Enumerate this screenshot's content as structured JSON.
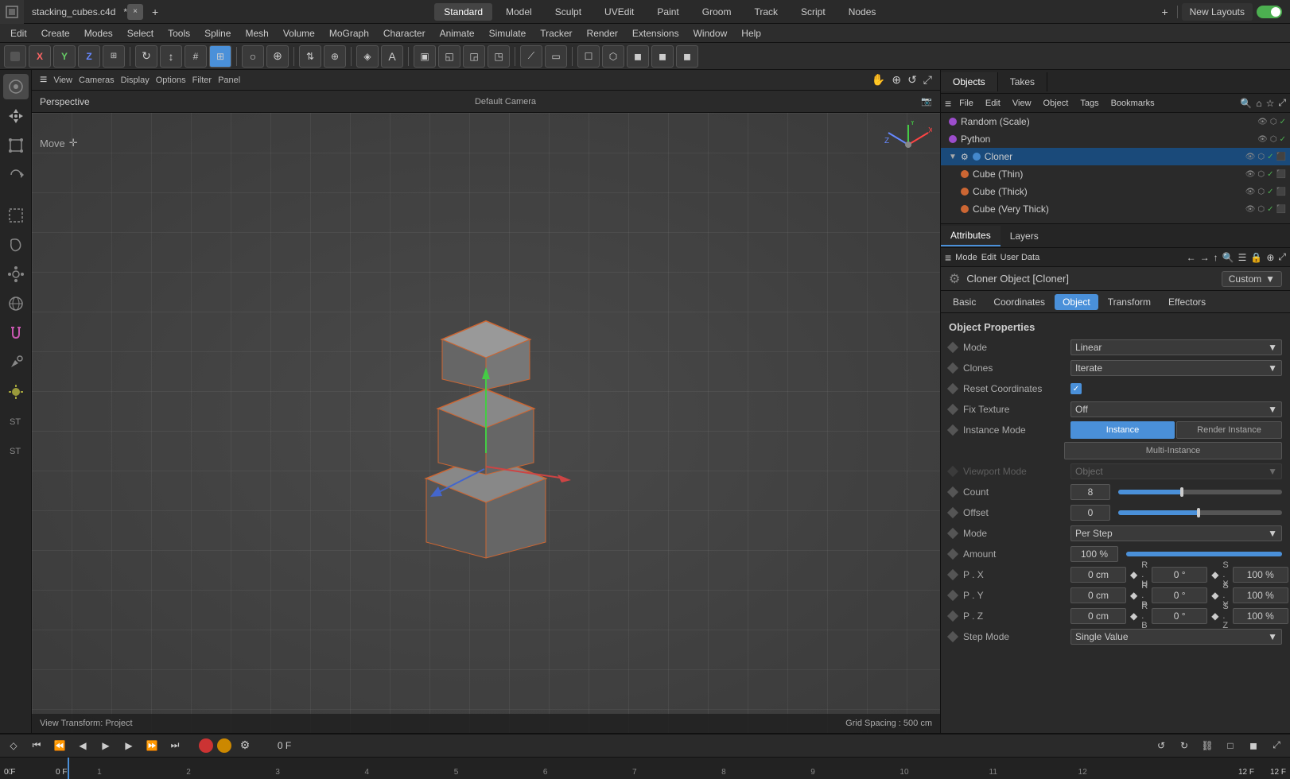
{
  "titlebar": {
    "file_name": "stacking_cubes.c4d",
    "modified": true,
    "close_label": "×",
    "add_tab_label": "+",
    "center_tabs": [
      {
        "label": "Standard",
        "active": true
      },
      {
        "label": "Model",
        "active": false
      },
      {
        "label": "Sculpt",
        "active": false
      },
      {
        "label": "UVEdit",
        "active": false
      },
      {
        "label": "Paint",
        "active": false
      },
      {
        "label": "Groom",
        "active": false
      },
      {
        "label": "Track",
        "active": false
      },
      {
        "label": "Script",
        "active": false
      },
      {
        "label": "Nodes",
        "active": false
      }
    ],
    "new_layouts_label": "New Layouts",
    "plus_icon": "+",
    "toggle_on": true
  },
  "menubar": {
    "items": [
      {
        "label": "Edit"
      },
      {
        "label": "Create"
      },
      {
        "label": "Modes"
      },
      {
        "label": "Select"
      },
      {
        "label": "Tools"
      },
      {
        "label": "Spline"
      },
      {
        "label": "Mesh"
      },
      {
        "label": "Volume"
      },
      {
        "label": "MoGraph"
      },
      {
        "label": "Character"
      },
      {
        "label": "Animate"
      },
      {
        "label": "Simulate"
      },
      {
        "label": "Tracker"
      },
      {
        "label": "Render"
      },
      {
        "label": "Extensions"
      },
      {
        "label": "Window"
      },
      {
        "label": "Help"
      }
    ]
  },
  "viewport": {
    "perspective_label": "Perspective",
    "camera_label": "Default Camera",
    "move_label": "Move",
    "grid_spacing": "Grid Spacing : 500 cm",
    "view_transform": "View Transform: Project",
    "view_tabs": [
      "View",
      "Cameras",
      "Display",
      "Options",
      "Filter",
      "Panel"
    ],
    "axis": {
      "x_color": "#ff4444",
      "y_color": "#44cc44",
      "z_color": "#4444ff"
    }
  },
  "right_panel": {
    "tabs": [
      {
        "label": "Objects",
        "active": true
      },
      {
        "label": "Takes",
        "active": false
      }
    ],
    "panel_tools": [
      "File",
      "Edit",
      "View",
      "Object",
      "Tags",
      "Bookmarks"
    ],
    "objects": [
      {
        "name": "Random (Scale)",
        "type": "effector",
        "indent": 0,
        "dot_color": "purple",
        "has_checkbox": true,
        "checked": true
      },
      {
        "name": "Python",
        "type": "script",
        "indent": 0,
        "dot_color": "purple",
        "has_checkbox": true,
        "checked": true
      },
      {
        "name": "Cloner",
        "type": "cloner",
        "indent": 0,
        "dot_color": "blue",
        "has_gear": true,
        "has_checkbox": true,
        "checked": true,
        "expanded": true
      },
      {
        "name": "Cube (Thin)",
        "type": "cube",
        "indent": 1,
        "dot_color": "orange",
        "has_checkbox": true,
        "checked": true
      },
      {
        "name": "Cube (Thick)",
        "type": "cube",
        "indent": 1,
        "dot_color": "orange",
        "has_checkbox": true,
        "checked": true
      },
      {
        "name": "Cube (Very Thick)",
        "type": "cube",
        "indent": 1,
        "dot_color": "orange",
        "has_checkbox": true,
        "checked": true
      }
    ]
  },
  "attributes": {
    "tabs": [
      {
        "label": "Attributes",
        "active": true
      },
      {
        "label": "Layers",
        "active": false
      }
    ],
    "mode_tabs": [
      "Mode",
      "Edit",
      "User Data"
    ],
    "cloner_title": "Cloner Object [Cloner]",
    "preset_dropdown": "Custom",
    "property_tabs": [
      {
        "label": "Basic",
        "active": false
      },
      {
        "label": "Coordinates",
        "active": false
      },
      {
        "label": "Object",
        "active": true
      },
      {
        "label": "Transform",
        "active": false
      },
      {
        "label": "Effectors",
        "active": false
      }
    ],
    "section_title": "Object Properties",
    "properties": {
      "mode": {
        "label": "Mode",
        "value": "Linear"
      },
      "clones": {
        "label": "Clones",
        "value": "Iterate"
      },
      "reset_coordinates": {
        "label": "Reset Coordinates",
        "checked": true
      },
      "fix_texture": {
        "label": "Fix Texture",
        "value": "Off"
      },
      "instance_mode": {
        "label": "Instance Mode",
        "value": "Instance"
      },
      "instance_btn": "Instance",
      "render_instance_btn": "Render Instance",
      "multi_instance_btn": "Multi-Instance",
      "viewport_mode": {
        "label": "Viewport Mode",
        "value": "Object",
        "disabled": true
      },
      "count": {
        "label": "Count",
        "value": "8",
        "slider_pct": 40
      },
      "offset": {
        "label": "Offset",
        "value": "0"
      },
      "mode2": {
        "label": "Mode",
        "value": "Per Step"
      },
      "amount": {
        "label": "Amount",
        "value": "100 %",
        "slider_pct": 100
      },
      "px": {
        "label": "P . X",
        "value": "0 cm"
      },
      "rh": {
        "label": "R . H",
        "value": "0 °"
      },
      "sx": {
        "label": "S . X",
        "value": "100 %"
      },
      "py": {
        "label": "P . Y",
        "value": "0 cm"
      },
      "rp": {
        "label": "R . P",
        "value": "0 °"
      },
      "sy": {
        "label": "S . Y",
        "value": "100 %"
      },
      "pz": {
        "label": "P . Z",
        "value": "0 cm"
      },
      "rb": {
        "label": "R . B",
        "value": "0 °"
      },
      "sz": {
        "label": "S . Z",
        "value": "100 %"
      },
      "step_mode": {
        "label": "Step Mode",
        "value": "Single Value"
      }
    }
  },
  "timeline": {
    "current_frame": "0 F",
    "start_frame": "0 F",
    "end_frame": "12 F",
    "end_frame2": "12 F",
    "ruler_marks": [
      0,
      1,
      2,
      3,
      4,
      5,
      6,
      7,
      8,
      9,
      10,
      11,
      12
    ]
  },
  "icons": {
    "move": "✛",
    "gear": "⚙",
    "check": "✓",
    "arrow_down": "▼",
    "arrow_right": "▶",
    "arrow_left": "◀",
    "diamond": "◆",
    "hamburger": "≡",
    "search": "🔍",
    "home": "⌂",
    "back": "←",
    "forward": "→",
    "up": "↑",
    "filter": "☰",
    "lock": "🔒",
    "expand": "⊞",
    "dot": "●"
  }
}
